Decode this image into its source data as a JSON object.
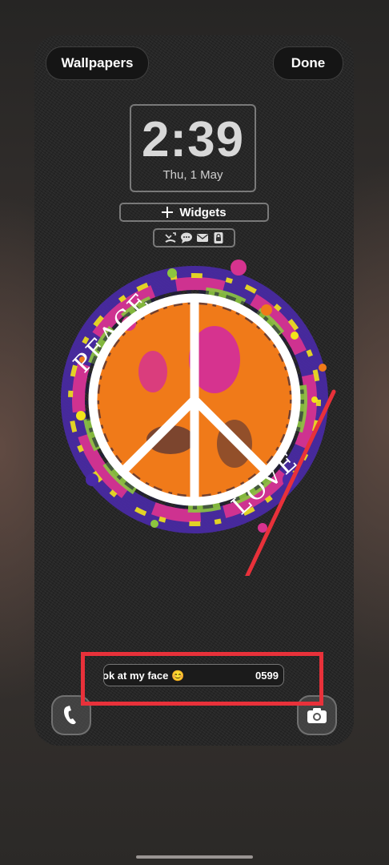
{
  "header": {
    "wallpapers_label": "Wallpapers",
    "done_label": "Done"
  },
  "clock": {
    "time": "2:39",
    "date": "Thu, 1 May"
  },
  "widgets": {
    "label": "Widgets"
  },
  "notifications": {
    "icons": [
      "missed-call-icon",
      "chat-bubble-icon",
      "mail-icon",
      "lock-icon"
    ]
  },
  "wallpaper": {
    "top_text": "PEACE",
    "bottom_text": "LOVE",
    "colors": {
      "orange": "#f07a19",
      "magenta": "#d6338f",
      "purple": "#4a2aa8",
      "green": "#8cc63f",
      "yellow": "#f2e41a"
    }
  },
  "ticker": {
    "text": "ok at my face 😊",
    "number": "0599"
  },
  "annotation": {
    "color": "#e8313a"
  },
  "shortcuts": {
    "left_icon": "phone-icon",
    "right_icon": "camera-icon"
  }
}
